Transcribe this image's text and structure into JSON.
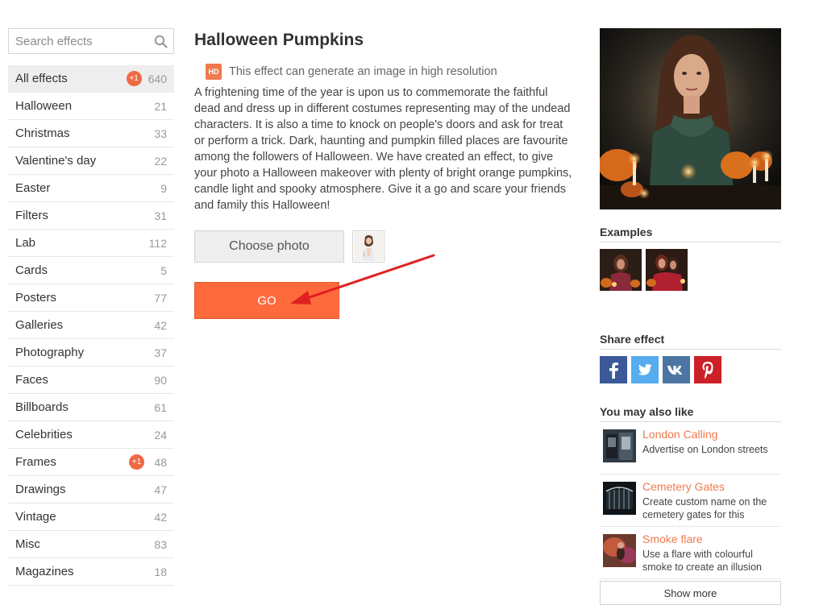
{
  "search": {
    "placeholder": "Search effects",
    "icon": "search-icon"
  },
  "categories": [
    {
      "label": "All effects",
      "count": "640",
      "badge": "+1",
      "active": true
    },
    {
      "label": "Halloween",
      "count": "21"
    },
    {
      "label": "Christmas",
      "count": "33"
    },
    {
      "label": "Valentine's day",
      "count": "22"
    },
    {
      "label": "Easter",
      "count": "9"
    },
    {
      "label": "Filters",
      "count": "31"
    },
    {
      "label": "Lab",
      "count": "112"
    },
    {
      "label": "Cards",
      "count": "5"
    },
    {
      "label": "Posters",
      "count": "77"
    },
    {
      "label": "Galleries",
      "count": "42"
    },
    {
      "label": "Photography",
      "count": "37"
    },
    {
      "label": "Faces",
      "count": "90"
    },
    {
      "label": "Billboards",
      "count": "61"
    },
    {
      "label": "Celebrities",
      "count": "24"
    },
    {
      "label": "Frames",
      "count": "48",
      "badge": "+1"
    },
    {
      "label": "Drawings",
      "count": "47"
    },
    {
      "label": "Vintage",
      "count": "42"
    },
    {
      "label": "Misc",
      "count": "83"
    },
    {
      "label": "Magazines",
      "count": "18"
    }
  ],
  "main": {
    "title": "Halloween Pumpkins",
    "hd_badge": "HD",
    "hd_text": "This effect can generate an image in high resolution",
    "description": "A frightening time of the year is upon us to commemorate the faithful dead and dress up in different costumes representing may of the undead characters. It is also a time to knock on people's doors and ask for treat or perform a trick. Dark, haunting and pumpkin filled places are favourite among the followers of Halloween. We have created an effect, to give your photo a Halloween makeover with plenty of bright orange pumpkins, candle light and spooky atmosphere. Give it a go and scare your friends and family this Halloween!",
    "choose_photo_label": "Choose photo",
    "go_label": "GO"
  },
  "right": {
    "examples_title": "Examples",
    "share_title": "Share effect",
    "share": [
      {
        "name": "facebook-icon",
        "color": "#3b5998"
      },
      {
        "name": "twitter-icon",
        "color": "#55acee"
      },
      {
        "name": "vk-icon",
        "color": "#4c75a3"
      },
      {
        "name": "pinterest-icon",
        "color": "#cb2027"
      }
    ],
    "related_title": "You may also like",
    "related": [
      {
        "title": "London Calling",
        "desc": "Advertise on London streets"
      },
      {
        "title": "Cemetery Gates",
        "desc": "Create custom name on the cemetery gates for this"
      },
      {
        "title": "Smoke flare",
        "desc": "Use a flare with colourful smoke to create an illusion"
      }
    ],
    "show_more_label": "Show more"
  },
  "colors": {
    "accent": "#ff6a3d",
    "link": "#ee7a4f",
    "badge": "#ee6a45"
  }
}
